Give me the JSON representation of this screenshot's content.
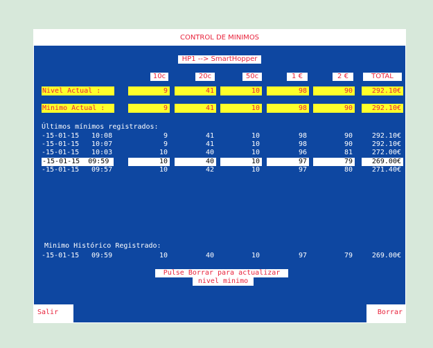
{
  "window": {
    "title": "CONTROL DE MINIMOS",
    "subtitle": "HP1 --> SmartHopper"
  },
  "headers": [
    "10c",
    "20c",
    "50c",
    "1 €",
    "2 €",
    "TOTAL"
  ],
  "nivel_actual": {
    "label": "Nivel Actual   :",
    "values": [
      "9",
      "41",
      "10",
      "98",
      "90",
      "292.10€"
    ]
  },
  "minimo_actual": {
    "label": "Minimo Actual  :",
    "values": [
      "9",
      "41",
      "10",
      "98",
      "90",
      "292.10€"
    ]
  },
  "ultimos": {
    "heading": "Últimos mínimos registrados:",
    "rows": [
      {
        "date": "-15-01-15",
        "time": "10:08",
        "values": [
          "9",
          "41",
          "10",
          "98",
          "90",
          "292.10€"
        ]
      },
      {
        "date": "-15-01-15",
        "time": "10:07",
        "values": [
          "9",
          "41",
          "10",
          "98",
          "90",
          "292.10€"
        ]
      },
      {
        "date": "-15-01-15",
        "time": "10:03",
        "values": [
          "10",
          "40",
          "10",
          "96",
          "81",
          "272.00€"
        ]
      },
      {
        "date": "-15-01-15",
        "time": "09:59",
        "values": [
          "10",
          "40",
          "10",
          "97",
          "79",
          "269.00€"
        ]
      },
      {
        "date": "-15-01-15",
        "time": "09:57",
        "values": [
          "10",
          "42",
          "10",
          "97",
          "80",
          "271.40€"
        ]
      }
    ]
  },
  "historico": {
    "heading": "Minimo Histórico Registrado:",
    "date": "-15-01-15",
    "time": "09:59",
    "values": [
      "10",
      "40",
      "10",
      "97",
      "79",
      "269.00€"
    ]
  },
  "message": {
    "line1": "Pulse Borrar para actualizar",
    "line2": "nivel minimo"
  },
  "buttons": {
    "salir": "Salir",
    "borrar": "Borrar"
  },
  "colors": {
    "background": "#0e47a1",
    "highlight_yellow": "#ffff2a",
    "accent_red": "#e8213a"
  }
}
